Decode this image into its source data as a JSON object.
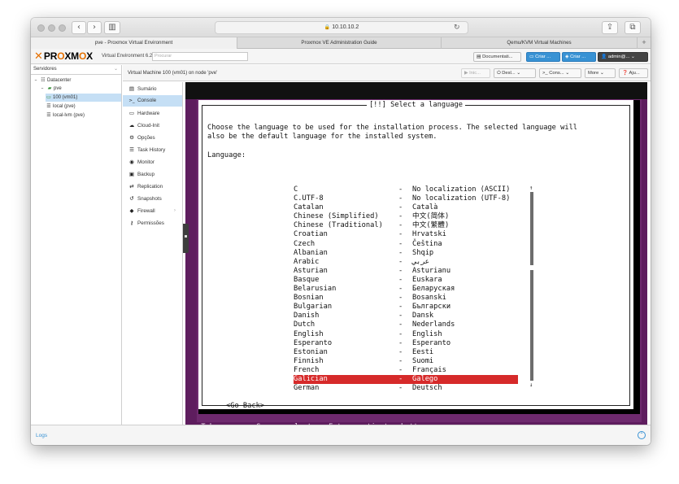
{
  "browser": {
    "url": "10.10.10.2",
    "tabs": [
      {
        "label": "pve - Proxmox Virtual Environment",
        "active": true
      },
      {
        "label": "Proxmox VE Administration Guide",
        "active": false
      },
      {
        "label": "Qemu/KVM Virtual Machines",
        "active": false
      }
    ]
  },
  "header": {
    "version": "Virtual Environment 6.2-11",
    "search_placeholder": "Procurar",
    "documentation": "Documentati...",
    "create_vm": "Criar ...",
    "create_ct": "Criar ...",
    "user": "admin@..."
  },
  "tree": {
    "view": "Servidores",
    "items": [
      {
        "label": "Datacenter",
        "icon": "datacenter-icon"
      },
      {
        "label": "pve",
        "icon": "node-icon"
      },
      {
        "label": "100 (vm01)",
        "icon": "vm-icon"
      },
      {
        "label": "local (pve)",
        "icon": "storage-icon"
      },
      {
        "label": "local-lvm (pve)",
        "icon": "storage-icon"
      }
    ]
  },
  "content": {
    "title": "Virtual Machine 100 (vm01) on node 'pve'",
    "buttons": {
      "start": "Inic...",
      "shutdown": "Desl...",
      "console": "Cons...",
      "more": "More",
      "help": "Aju..."
    }
  },
  "vmnav": [
    {
      "label": "Sumário",
      "icon": "summary-icon",
      "glyph": "▤"
    },
    {
      "label": "Console",
      "icon": "console-icon",
      "glyph": ">_"
    },
    {
      "label": "Hardware",
      "icon": "hardware-icon",
      "glyph": "▭"
    },
    {
      "label": "Cloud-Init",
      "icon": "cloud-icon",
      "glyph": "☁"
    },
    {
      "label": "Opções",
      "icon": "options-icon",
      "glyph": "⚙"
    },
    {
      "label": "Task History",
      "icon": "task-history-icon",
      "glyph": "☰"
    },
    {
      "label": "Monitor",
      "icon": "monitor-eye-icon",
      "glyph": "◉"
    },
    {
      "label": "Backup",
      "icon": "backup-icon",
      "glyph": "▣"
    },
    {
      "label": "Replication",
      "icon": "replication-icon",
      "glyph": "⇄"
    },
    {
      "label": "Snapshots",
      "icon": "snapshots-icon",
      "glyph": "↺"
    },
    {
      "label": "Firewall",
      "icon": "firewall-shield-icon",
      "glyph": "◆"
    },
    {
      "label": "Permissões",
      "icon": "permissions-key-icon",
      "glyph": "⚷"
    }
  ],
  "installer": {
    "title": "[!!] Select a language",
    "instruction_line1": "Choose the language to be used for the installation process. The selected language will",
    "instruction_line2": "also be the default language for the installed system.",
    "language_label": "Language:",
    "languages": [
      {
        "name": "C",
        "native": "No localization (ASCII)"
      },
      {
        "name": "C.UTF-8",
        "native": "No localization (UTF-8)"
      },
      {
        "name": "Catalan",
        "native": "Català"
      },
      {
        "name": "Chinese (Simplified)",
        "native": "中文(简体)"
      },
      {
        "name": "Chinese (Traditional)",
        "native": "中文(繁體)"
      },
      {
        "name": "Croatian",
        "native": "Hrvatski"
      },
      {
        "name": "Czech",
        "native": "Čeština"
      },
      {
        "name": "Albanian",
        "native": "Shqip"
      },
      {
        "name": "Arabic",
        "native": "عربي"
      },
      {
        "name": "Asturian",
        "native": "Asturianu"
      },
      {
        "name": "Basque",
        "native": "Euskara"
      },
      {
        "name": "Belarusian",
        "native": "Беларуская"
      },
      {
        "name": "Bosnian",
        "native": "Bosanski"
      },
      {
        "name": "Bulgarian",
        "native": "Български"
      },
      {
        "name": "Danish",
        "native": "Dansk"
      },
      {
        "name": "Dutch",
        "native": "Nederlands"
      },
      {
        "name": "English",
        "native": "English"
      },
      {
        "name": "Esperanto",
        "native": "Esperanto"
      },
      {
        "name": "Estonian",
        "native": "Eesti"
      },
      {
        "name": "Finnish",
        "native": "Suomi"
      },
      {
        "name": "French",
        "native": "Français"
      },
      {
        "name": "Galician",
        "native": "Galego",
        "selected": true
      },
      {
        "name": "German",
        "native": "Deutsch"
      }
    ],
    "separator": "-",
    "go_back": "<Go Back>",
    "help": "<Tab> moves; <Space> selects; <Enter> activates buttons"
  },
  "logs": {
    "label": "Logs"
  },
  "colors": {
    "accent": "#3892d4",
    "brand_orange": "#e57000",
    "installer_background": "#6e2a6e",
    "selection_red": "#d62a2a"
  }
}
